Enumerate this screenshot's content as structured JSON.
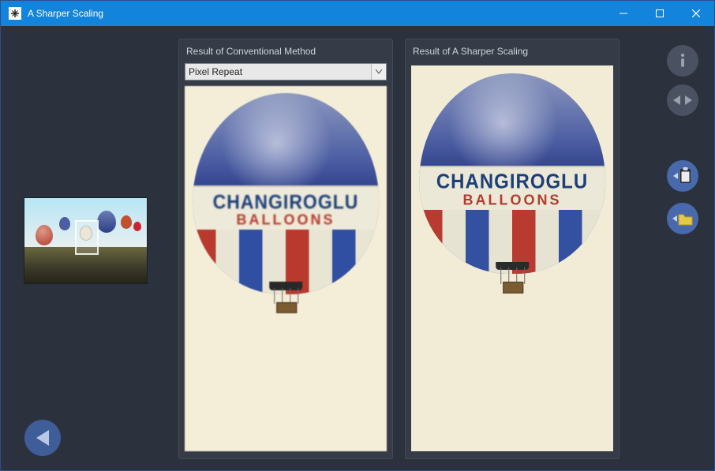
{
  "window": {
    "title": "A Sharper Scaling"
  },
  "panels": {
    "conventional_label": "Result of Conventional Method",
    "sharper_label": "Result of  A Sharper Scaling",
    "method_selected": "Pixel Repeat"
  },
  "balloon": {
    "line1": "CHANGIROGLU",
    "line2": "BALLOONS"
  },
  "icons": {
    "info": "info-icon",
    "compare": "compare-icon",
    "to_clipboard": "to-clipboard-icon",
    "to_file": "to-file-icon",
    "back": "back-icon"
  }
}
